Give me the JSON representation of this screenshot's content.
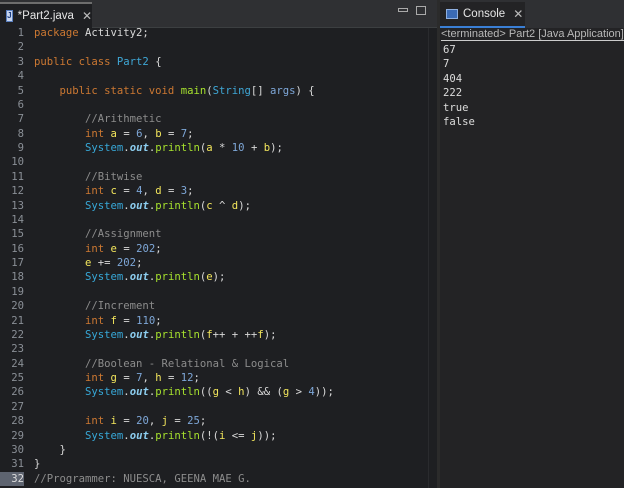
{
  "editor": {
    "tab_label": "*Part2.java",
    "lines": [
      [
        [
          "package ",
          "k"
        ],
        [
          "Activity2;",
          "t"
        ]
      ],
      [],
      [
        [
          "public class ",
          "k"
        ],
        [
          "Part2",
          "cl"
        ],
        [
          " {",
          "t"
        ]
      ],
      [],
      [
        [
          "    public static void ",
          "k"
        ],
        [
          "main",
          "m"
        ],
        [
          "(",
          "t"
        ],
        [
          "String",
          "cl"
        ],
        [
          "[] ",
          "t"
        ],
        [
          "args",
          "n"
        ],
        [
          ") {",
          "t"
        ]
      ],
      [],
      [
        [
          "        //Arithmetic",
          "c"
        ]
      ],
      [
        [
          "        int ",
          "k"
        ],
        [
          "a",
          "v"
        ],
        [
          " = ",
          "t"
        ],
        [
          "6",
          "n"
        ],
        [
          ", ",
          "t"
        ],
        [
          "b",
          "v"
        ],
        [
          " = ",
          "t"
        ],
        [
          "7",
          "n"
        ],
        [
          ";",
          "t"
        ]
      ],
      [
        [
          "        System",
          "s"
        ],
        [
          ".",
          "t"
        ],
        [
          "out",
          "o"
        ],
        [
          ".",
          "t"
        ],
        [
          "println",
          "m"
        ],
        [
          "(",
          "t"
        ],
        [
          "a",
          "v"
        ],
        [
          " * ",
          "t"
        ],
        [
          "10",
          "n"
        ],
        [
          " + ",
          "t"
        ],
        [
          "b",
          "v"
        ],
        [
          ");",
          "t"
        ]
      ],
      [],
      [
        [
          "        //Bitwise",
          "c"
        ]
      ],
      [
        [
          "        int ",
          "k"
        ],
        [
          "c",
          "v"
        ],
        [
          " = ",
          "t"
        ],
        [
          "4",
          "n"
        ],
        [
          ", ",
          "t"
        ],
        [
          "d",
          "v"
        ],
        [
          " = ",
          "t"
        ],
        [
          "3",
          "n"
        ],
        [
          ";",
          "t"
        ]
      ],
      [
        [
          "        System",
          "s"
        ],
        [
          ".",
          "t"
        ],
        [
          "out",
          "o"
        ],
        [
          ".",
          "t"
        ],
        [
          "println",
          "m"
        ],
        [
          "(",
          "t"
        ],
        [
          "c",
          "v"
        ],
        [
          " ^ ",
          "t"
        ],
        [
          "d",
          "v"
        ],
        [
          ");",
          "t"
        ]
      ],
      [],
      [
        [
          "        //Assignment",
          "c"
        ]
      ],
      [
        [
          "        int ",
          "k"
        ],
        [
          "e",
          "v"
        ],
        [
          " = ",
          "t"
        ],
        [
          "202",
          "n"
        ],
        [
          ";",
          "t"
        ]
      ],
      [
        [
          "        e",
          "v"
        ],
        [
          " += ",
          "t"
        ],
        [
          "202",
          "n"
        ],
        [
          ";",
          "t"
        ]
      ],
      [
        [
          "        System",
          "s"
        ],
        [
          ".",
          "t"
        ],
        [
          "out",
          "o"
        ],
        [
          ".",
          "t"
        ],
        [
          "println",
          "m"
        ],
        [
          "(",
          "t"
        ],
        [
          "e",
          "v"
        ],
        [
          ");",
          "t"
        ]
      ],
      [],
      [
        [
          "        //Increment",
          "c"
        ]
      ],
      [
        [
          "        int ",
          "k"
        ],
        [
          "f",
          "v"
        ],
        [
          " = ",
          "t"
        ],
        [
          "110",
          "n"
        ],
        [
          ";",
          "t"
        ]
      ],
      [
        [
          "        System",
          "s"
        ],
        [
          ".",
          "t"
        ],
        [
          "out",
          "o"
        ],
        [
          ".",
          "t"
        ],
        [
          "println",
          "m"
        ],
        [
          "(",
          "t"
        ],
        [
          "f",
          "v"
        ],
        [
          "++ + ++",
          "t"
        ],
        [
          "f",
          "v"
        ],
        [
          ");",
          "t"
        ]
      ],
      [],
      [
        [
          "        //Boolean - Relational & Logical",
          "c"
        ]
      ],
      [
        [
          "        int ",
          "k"
        ],
        [
          "g",
          "v"
        ],
        [
          " = ",
          "t"
        ],
        [
          "7",
          "n"
        ],
        [
          ", ",
          "t"
        ],
        [
          "h",
          "v"
        ],
        [
          " = ",
          "t"
        ],
        [
          "12",
          "n"
        ],
        [
          ";",
          "t"
        ]
      ],
      [
        [
          "        System",
          "s"
        ],
        [
          ".",
          "t"
        ],
        [
          "out",
          "o"
        ],
        [
          ".",
          "t"
        ],
        [
          "println",
          "m"
        ],
        [
          "((",
          "t"
        ],
        [
          "g",
          "v"
        ],
        [
          " < ",
          "t"
        ],
        [
          "h",
          "v"
        ],
        [
          ") && (",
          "t"
        ],
        [
          "g",
          "v"
        ],
        [
          " > ",
          "t"
        ],
        [
          "4",
          "n"
        ],
        [
          "));",
          "t"
        ]
      ],
      [],
      [
        [
          "        int ",
          "k"
        ],
        [
          "i",
          "v"
        ],
        [
          " = ",
          "t"
        ],
        [
          "20",
          "n"
        ],
        [
          ", ",
          "t"
        ],
        [
          "j",
          "v"
        ],
        [
          " = ",
          "t"
        ],
        [
          "25",
          "n"
        ],
        [
          ";",
          "t"
        ]
      ],
      [
        [
          "        System",
          "s"
        ],
        [
          ".",
          "t"
        ],
        [
          "out",
          "o"
        ],
        [
          ".",
          "t"
        ],
        [
          "println",
          "m"
        ],
        [
          "(!(",
          "t"
        ],
        [
          "i",
          "v"
        ],
        [
          " <= ",
          "t"
        ],
        [
          "j",
          "v"
        ],
        [
          "));",
          "t"
        ]
      ],
      [
        [
          "    }",
          "t"
        ]
      ],
      [
        [
          "}",
          "t"
        ]
      ],
      [
        [
          "//Programmer: NUESCA, GEENA MAE G.",
          "c"
        ]
      ]
    ],
    "current_line": 32
  },
  "console": {
    "tab_label": "Console",
    "status": "<terminated> Part2 [Java Application]",
    "output": [
      "67",
      "7",
      "404",
      "222",
      "true",
      "false"
    ]
  }
}
